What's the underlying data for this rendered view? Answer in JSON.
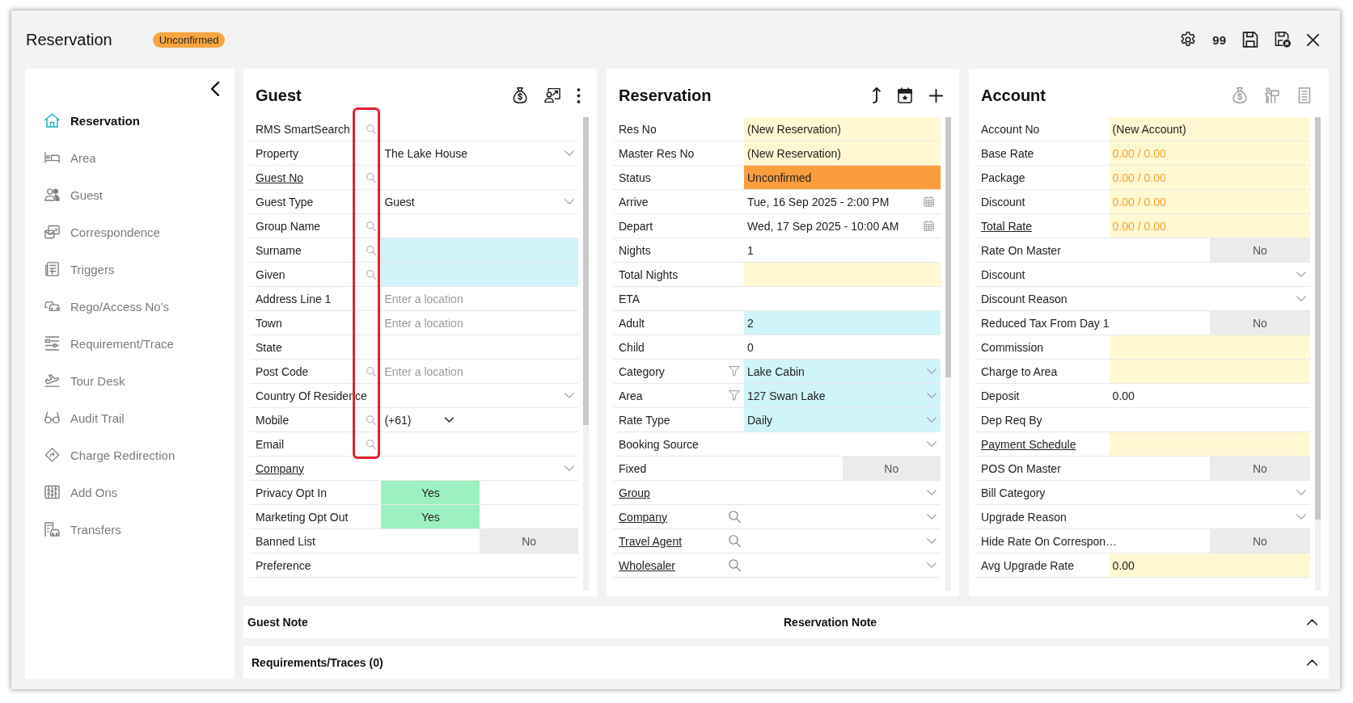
{
  "window": {
    "title": "Reservation",
    "status": "Unconfirmed"
  },
  "toolbar": {
    "count": "99"
  },
  "sidebar": {
    "items": [
      {
        "label": "Reservation",
        "selected": true
      },
      {
        "label": "Area",
        "selected": false
      },
      {
        "label": "Guest",
        "selected": false
      },
      {
        "label": "Correspondence",
        "selected": false
      },
      {
        "label": "Triggers",
        "selected": false
      },
      {
        "label": "Rego/Access No's",
        "selected": false
      },
      {
        "label": "Requirement/Trace",
        "selected": false
      },
      {
        "label": "Tour Desk",
        "selected": false
      },
      {
        "label": "Audit Trail",
        "selected": false
      },
      {
        "label": "Charge Redirection",
        "selected": false
      },
      {
        "label": "Add Ons",
        "selected": false
      },
      {
        "label": "Transfers",
        "selected": false
      }
    ]
  },
  "panels": [
    {
      "title": "Guest",
      "actions_disabled": false,
      "rows": [
        {
          "label": "RMS SmartSearch",
          "link": false,
          "searchable": true,
          "kind": "input",
          "required": false,
          "readonly": false
        },
        {
          "label": "Property",
          "link": false,
          "searchable": false,
          "kind": "select",
          "required": false,
          "readonly": false,
          "value": "The Lake House"
        },
        {
          "label": "Guest No",
          "link": true,
          "searchable": true,
          "kind": "input",
          "required": false,
          "readonly": false
        },
        {
          "label": "Guest Type",
          "link": false,
          "searchable": false,
          "kind": "select",
          "required": false,
          "readonly": false,
          "value": "Guest"
        },
        {
          "label": "Group Name",
          "link": false,
          "searchable": true,
          "kind": "input",
          "required": false,
          "readonly": false
        },
        {
          "label": "Surname",
          "link": false,
          "searchable": true,
          "kind": "input",
          "required": true,
          "readonly": false
        },
        {
          "label": "Given",
          "link": false,
          "searchable": true,
          "kind": "input",
          "required": true,
          "readonly": false
        },
        {
          "label": "Address Line 1",
          "link": false,
          "searchable": false,
          "kind": "input",
          "required": false,
          "readonly": false,
          "placeholder": "Enter a location"
        },
        {
          "label": "Town",
          "link": false,
          "searchable": false,
          "kind": "input",
          "required": false,
          "readonly": false,
          "placeholder": "Enter a location"
        },
        {
          "label": "State",
          "link": false,
          "searchable": false,
          "kind": "input",
          "required": false,
          "readonly": false
        },
        {
          "label": "Post Code",
          "link": false,
          "searchable": true,
          "kind": "input",
          "required": false,
          "readonly": false,
          "placeholder": "Enter a location"
        },
        {
          "label": "Country Of Residence",
          "link": false,
          "searchable": false,
          "kind": "select",
          "required": false,
          "readonly": false
        },
        {
          "label": "Mobile",
          "link": false,
          "searchable": true,
          "kind": "phone",
          "required": false,
          "readonly": false,
          "code": "(+61)"
        },
        {
          "label": "Email",
          "link": false,
          "searchable": true,
          "kind": "input",
          "required": false,
          "readonly": false
        },
        {
          "label": "Company",
          "link": true,
          "searchable": false,
          "kind": "select",
          "required": false,
          "readonly": false
        },
        {
          "label": "Privacy Opt In",
          "link": false,
          "searchable": false,
          "kind": "toggle",
          "value": "Yes",
          "on": true
        },
        {
          "label": "Marketing Opt Out",
          "link": false,
          "searchable": false,
          "kind": "toggle",
          "value": "Yes",
          "on": true
        },
        {
          "label": "Banned List",
          "link": false,
          "searchable": false,
          "kind": "toggle",
          "value": "No",
          "on": false
        },
        {
          "label": "Preference",
          "link": false,
          "searchable": false,
          "kind": "input",
          "required": false,
          "readonly": false
        }
      ]
    },
    {
      "title": "Reservation",
      "actions_disabled": false,
      "rows": [
        {
          "label": "Res No",
          "link": false,
          "searchable": false,
          "filterable": false,
          "kind": "input",
          "required": false,
          "readonly": true,
          "value": "(New Reservation)"
        },
        {
          "label": "Master Res No",
          "link": false,
          "searchable": false,
          "filterable": false,
          "kind": "input",
          "required": false,
          "readonly": true,
          "value": "(New Reservation)"
        },
        {
          "label": "Status",
          "link": false,
          "searchable": false,
          "filterable": false,
          "kind": "status",
          "value": "Unconfirmed"
        },
        {
          "label": "Arrive",
          "link": false,
          "searchable": false,
          "filterable": false,
          "kind": "date",
          "required": false,
          "readonly": false,
          "value": "Tue, 16 Sep 2025 - 2:00 PM"
        },
        {
          "label": "Depart",
          "link": false,
          "searchable": false,
          "filterable": false,
          "kind": "date",
          "required": false,
          "readonly": false,
          "value": "Wed, 17 Sep 2025 - 10:00 AM"
        },
        {
          "label": "Nights",
          "link": false,
          "searchable": false,
          "filterable": false,
          "kind": "input",
          "required": false,
          "readonly": false,
          "value": "1"
        },
        {
          "label": "Total Nights",
          "link": false,
          "searchable": false,
          "filterable": false,
          "kind": "input",
          "required": false,
          "readonly": true
        },
        {
          "label": "ETA",
          "link": false,
          "searchable": false,
          "filterable": false,
          "kind": "input",
          "required": false,
          "readonly": false
        },
        {
          "label": "Adult",
          "link": false,
          "searchable": false,
          "filterable": false,
          "kind": "input",
          "required": true,
          "readonly": false,
          "value": "2"
        },
        {
          "label": "Child",
          "link": false,
          "searchable": false,
          "filterable": false,
          "kind": "input",
          "required": false,
          "readonly": false,
          "value": "0"
        },
        {
          "label": "Category",
          "link": false,
          "searchable": false,
          "filterable": true,
          "kind": "select",
          "required": true,
          "readonly": false,
          "value": "Lake Cabin"
        },
        {
          "label": "Area",
          "link": false,
          "searchable": false,
          "filterable": true,
          "kind": "select",
          "required": true,
          "readonly": false,
          "value": "127 Swan Lake"
        },
        {
          "label": "Rate Type",
          "link": false,
          "searchable": false,
          "filterable": false,
          "kind": "select",
          "required": true,
          "readonly": false,
          "value": "Daily"
        },
        {
          "label": "Booking Source",
          "link": false,
          "searchable": false,
          "filterable": false,
          "kind": "select",
          "required": false,
          "readonly": false
        },
        {
          "label": "Fixed",
          "link": false,
          "searchable": false,
          "filterable": false,
          "kind": "toggle",
          "value": "No",
          "on": false
        },
        {
          "label": "Group",
          "link": true,
          "searchable": false,
          "filterable": false,
          "kind": "select",
          "required": false,
          "readonly": false
        },
        {
          "label": "Company",
          "link": true,
          "searchable": true,
          "filterable": false,
          "kind": "select",
          "required": false,
          "readonly": false
        },
        {
          "label": "Travel Agent",
          "link": true,
          "searchable": true,
          "filterable": false,
          "kind": "select",
          "required": false,
          "readonly": false
        },
        {
          "label": "Wholesaler",
          "link": true,
          "searchable": true,
          "filterable": false,
          "kind": "select",
          "required": false,
          "readonly": false
        }
      ]
    },
    {
      "title": "Account",
      "actions_disabled": true,
      "rows": [
        {
          "label": "Account No",
          "link": false,
          "kind": "input",
          "required": false,
          "readonly": true,
          "value": "(New Account)"
        },
        {
          "label": "Base Rate",
          "link": false,
          "kind": "rate",
          "required": false,
          "readonly": true,
          "value": "0.00 / 0.00"
        },
        {
          "label": "Package",
          "link": false,
          "kind": "rate",
          "required": false,
          "readonly": true,
          "value": "0.00 / 0.00"
        },
        {
          "label": "Discount",
          "link": false,
          "kind": "rate",
          "required": false,
          "readonly": true,
          "value": "0.00 / 0.00"
        },
        {
          "label": "Total Rate",
          "link": true,
          "kind": "rate",
          "required": false,
          "readonly": true,
          "value": "0.00 / 0.00"
        },
        {
          "label": "Rate On Master",
          "link": false,
          "kind": "toggle",
          "value": "No",
          "on": false
        },
        {
          "label": "Discount",
          "link": false,
          "kind": "select",
          "required": false,
          "readonly": false
        },
        {
          "label": "Discount Reason",
          "link": false,
          "kind": "select",
          "required": false,
          "readonly": false
        },
        {
          "label": "Reduced Tax From Day 1",
          "link": false,
          "kind": "toggle",
          "value": "No",
          "on": false
        },
        {
          "label": "Commission",
          "link": false,
          "kind": "input",
          "required": false,
          "readonly": true
        },
        {
          "label": "Charge to Area",
          "link": false,
          "kind": "input",
          "required": false,
          "readonly": true
        },
        {
          "label": "Deposit",
          "link": false,
          "kind": "input",
          "required": false,
          "readonly": false,
          "value": "0.00"
        },
        {
          "label": "Dep Req By",
          "link": false,
          "kind": "input",
          "required": false,
          "readonly": false
        },
        {
          "label": "Payment Schedule",
          "link": true,
          "kind": "input",
          "required": false,
          "readonly": true
        },
        {
          "label": "POS On Master",
          "link": false,
          "kind": "toggle",
          "value": "No",
          "on": false
        },
        {
          "label": "Bill Category",
          "link": false,
          "kind": "select",
          "required": false,
          "readonly": false
        },
        {
          "label": "Upgrade Reason",
          "link": false,
          "kind": "select",
          "required": false,
          "readonly": false
        },
        {
          "label": "Hide Rate On Correspon…",
          "link": false,
          "kind": "toggle",
          "value": "No",
          "on": false
        },
        {
          "label": "Avg Upgrade Rate",
          "link": false,
          "kind": "input",
          "required": false,
          "readonly": true,
          "value": "0.00"
        }
      ]
    }
  ],
  "notes_bar": {
    "left_title": "Guest Note",
    "right_title": "Reservation Note"
  },
  "requirements_bar": {
    "title": "Requirements/Traces (0)"
  }
}
